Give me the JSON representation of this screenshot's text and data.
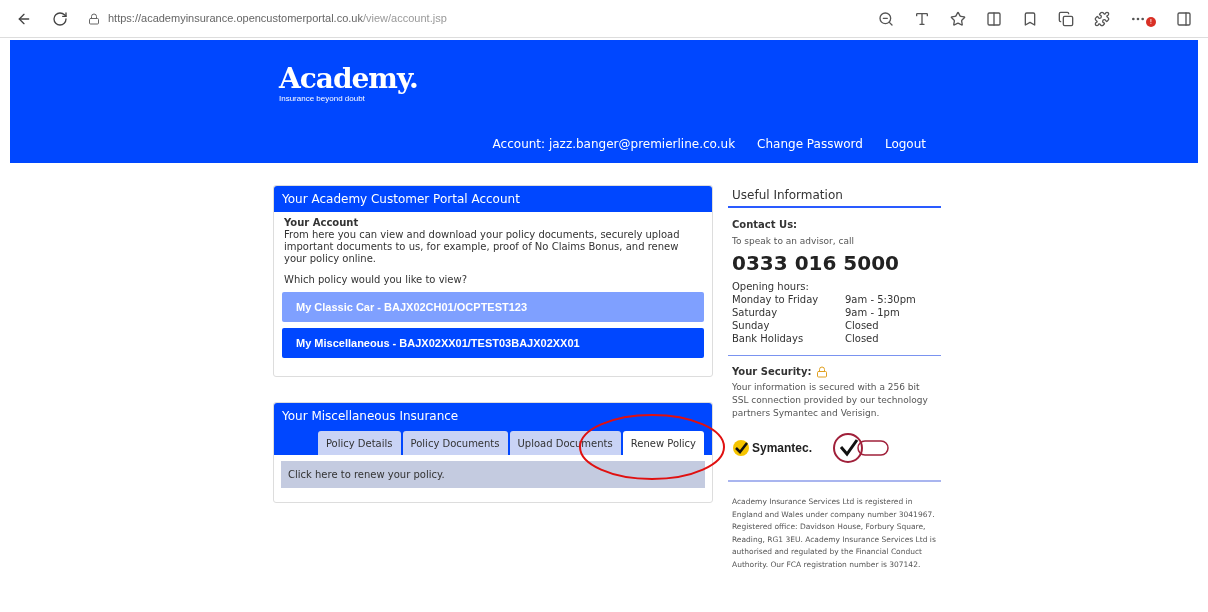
{
  "browser": {
    "url_host": "https://academyinsurance.opencustomerportal.co.uk",
    "url_path": "/view/account.jsp",
    "notification_badge": "!"
  },
  "header": {
    "logo": "Academy.",
    "tagline": "Insurance beyond doubt",
    "account": "Account: jazz.banger@premierline.co.uk",
    "links": [
      "Change Password",
      "Logout"
    ]
  },
  "account_panel": {
    "title": "Your Academy Customer Portal Account",
    "heading": "Your Account",
    "intro": "From here you can view and download your policy documents, securely upload important documents to us, for example, proof of No Claims Bonus, and renew your policy online.",
    "question": "Which policy would you like to view?",
    "policies": [
      {
        "label": "My Classic Car - BAJX02CH01/OCPTEST123",
        "selected": false
      },
      {
        "label": "My Miscellaneous - BAJX02XX01/TEST03BAJX02XX01",
        "selected": true
      }
    ]
  },
  "insurance_panel": {
    "title": "Your Miscellaneous Insurance",
    "tabs": [
      {
        "label": "Policy Details",
        "selected": false
      },
      {
        "label": "Policy Documents",
        "selected": false
      },
      {
        "label": "Upload Documents",
        "selected": false
      },
      {
        "label": "Renew Policy",
        "selected": true
      }
    ],
    "message": "Click here to renew your policy."
  },
  "useful_info": {
    "title": "Useful Information",
    "contact_heading": "Contact Us:",
    "contact_text": "To speak to an advisor, call",
    "phone": "0333 016 5000",
    "hours_heading": "Opening hours:",
    "hours": [
      {
        "day": "Monday to Friday",
        "time": "9am - 5:30pm"
      },
      {
        "day": "Saturday",
        "time": "9am - 1pm"
      },
      {
        "day": "Sunday",
        "time": "Closed"
      },
      {
        "day": "Bank Holidays",
        "time": "Closed"
      }
    ],
    "security_heading": "Your Security:",
    "security_text": "Your information is secured with a 256 bit SSL connection provided by our technology partners Symantec and Verisign.",
    "symantec": "Symantec.",
    "legal": "Academy Insurance Services Ltd is registered in England and Wales under company number 3041967. Registered office: Davidson House, Forbury Square, Reading, RG1 3EU. Academy Insurance Services Ltd is authorised and regulated by the Financial Conduct Authority. Our FCA registration number is 307142."
  }
}
